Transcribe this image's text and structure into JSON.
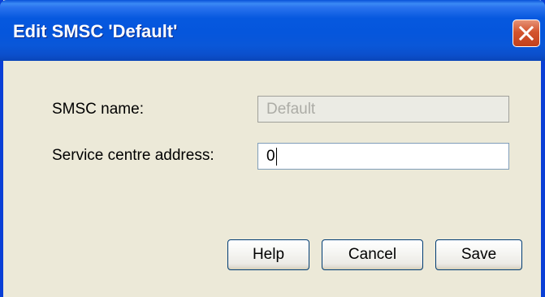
{
  "window": {
    "title": "Edit SMSC 'Default'"
  },
  "form": {
    "smsc_name_label": "SMSC name:",
    "smsc_name_value": "Default",
    "service_centre_label": "Service centre address:",
    "service_centre_value": "0"
  },
  "buttons": {
    "help": "Help",
    "cancel": "Cancel",
    "save": "Save"
  },
  "icons": {
    "close": "close-icon"
  },
  "colors": {
    "titlebar": "#0556dc",
    "dialog_background": "#ece9d8",
    "close_button": "#d3542e"
  }
}
